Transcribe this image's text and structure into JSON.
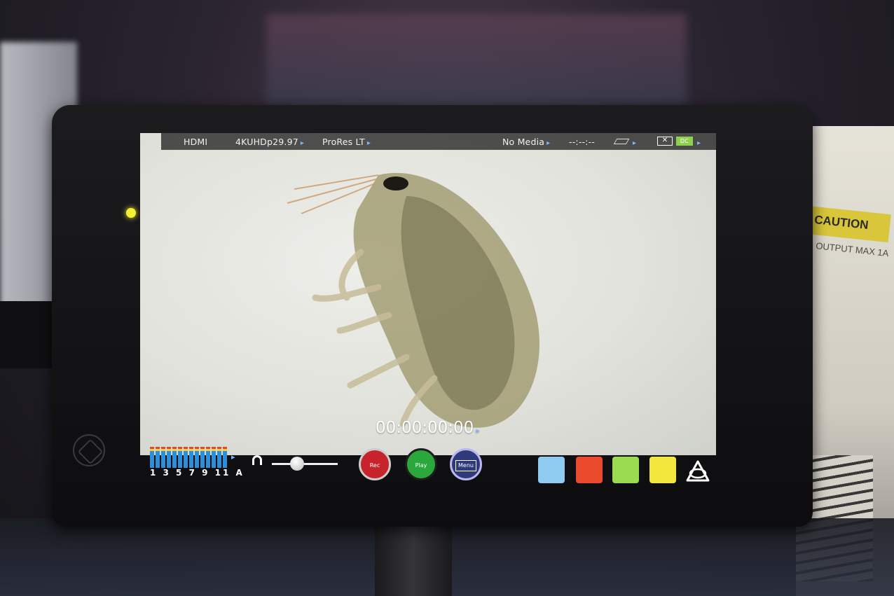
{
  "status_bar": {
    "input": "HDMI",
    "format": "4KUHDp29.97",
    "codec": "ProRes LT",
    "media": "No Media",
    "remaining": "--:--:--",
    "battery_label": "DC",
    "chevron": "▸"
  },
  "timecode": "00:00:00:00",
  "audio": {
    "channel_labels": "1 3 5 7 9 11 A"
  },
  "controls": {
    "rec_label": "Rec",
    "play_label": "Play",
    "menu_label": "Menu"
  },
  "background": {
    "caution_label": "CAUTION",
    "caution_sub": "OUTPUT MAX 1A"
  },
  "colors": {
    "rec": "#c8232b",
    "play": "#2aa83c",
    "menu": "#2e3a7a",
    "tool_blue": "#8fcaf0",
    "tool_red": "#ec4a2c",
    "tool_green": "#9bdb4f",
    "tool_yellow": "#f3e63c",
    "accent_chevron": "#7fb4ff"
  }
}
